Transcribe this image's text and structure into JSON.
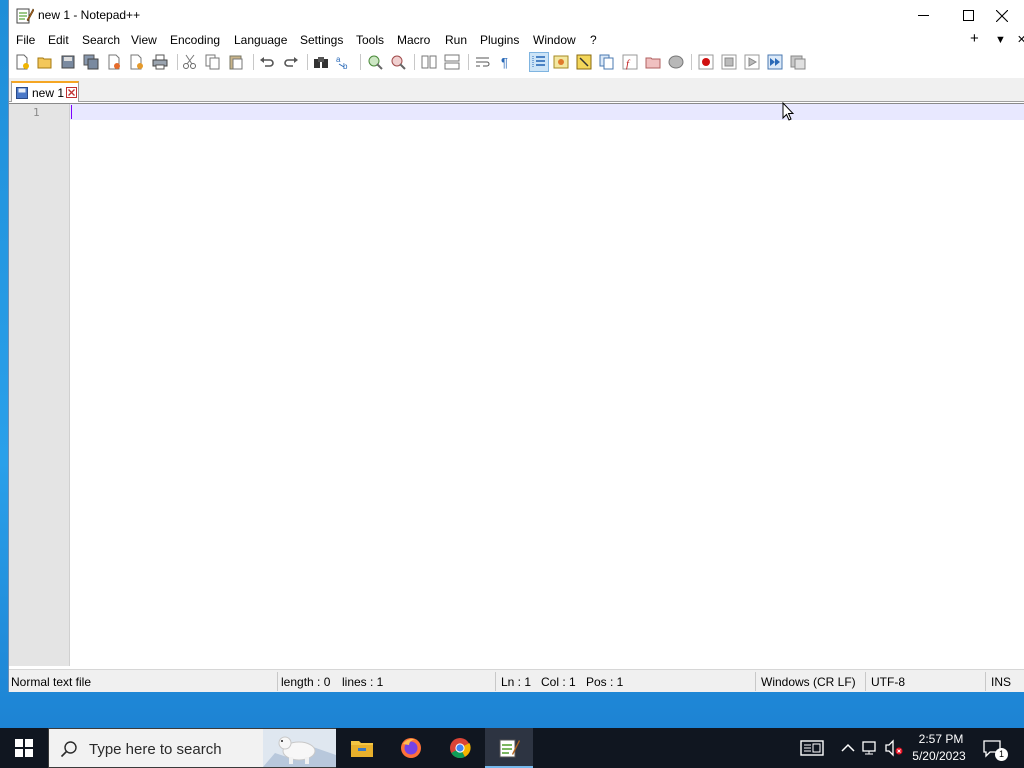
{
  "window": {
    "title": "new 1 - Notepad++"
  },
  "menubar": {
    "items": [
      "File",
      "Edit",
      "Search",
      "View",
      "Encoding",
      "Language",
      "Settings",
      "Tools",
      "Macro",
      "Run",
      "Plugins",
      "Window",
      "?"
    ],
    "right": {
      "add": "+",
      "dropdown": "▼",
      "close": "✕"
    }
  },
  "tabs": [
    {
      "label": "new 1"
    }
  ],
  "editor": {
    "line_numbers": [
      "1"
    ]
  },
  "statusbar": {
    "file_type": "Normal text file",
    "length": "length : 0",
    "lines": "lines : 1",
    "ln": "Ln : 1",
    "col": "Col : 1",
    "pos": "Pos : 1",
    "eol": "Windows (CR LF)",
    "encoding": "UTF-8",
    "mode": "INS"
  },
  "taskbar": {
    "search_placeholder": "Type here to search",
    "time": "2:57 PM",
    "date": "5/20/2023",
    "notification_count": "1"
  },
  "colors": {
    "current_line": "#e8e8ff",
    "tab_accent": "#f5a623",
    "taskbar": "#101620",
    "desktop": "#1f8ed8"
  }
}
